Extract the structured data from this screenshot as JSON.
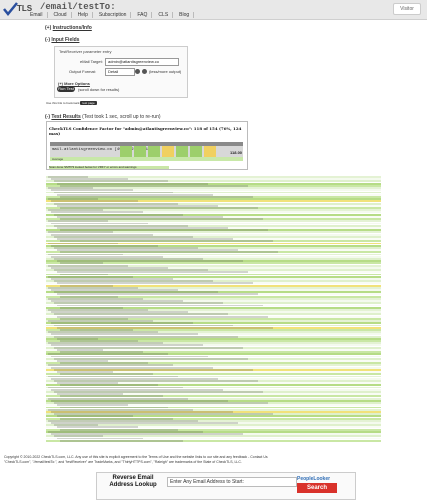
{
  "header": {
    "logo_text": "TLS",
    "path": "/email/testTo:",
    "menu": [
      "Email",
      "Cloud",
      "Help",
      "Subscription",
      "FAQ",
      "CLS",
      "Blog"
    ],
    "visitor_label": "Visitor"
  },
  "sections": {
    "instructions": "Instructions/Info",
    "input_fields": "Input Fields",
    "test_results": "Test Results",
    "test_results_hint": "(Test took 1 sec, scroll up to re-run)"
  },
  "form": {
    "legend": "TestReceiver parameter entry",
    "email_label": "eMail Target:",
    "email_value": "admin@atlantisgreenview.co",
    "output_label": "Output Format:",
    "output_value": "Detail",
    "output_hint": "(less/more output)",
    "more_options": "More Options",
    "run_button": "Run Test",
    "run_hint": "(scroll down for results)",
    "bookmark_note": "Use this link to bookmark",
    "bookmark_link": "test page"
  },
  "results": {
    "title": "CheckTLS Confidence Factor for \"admin@atlantisgreenview.co\": 118 of 154 (76%, 124 max)",
    "server_row": "mail.atlantisgreenview.co [49.76.227.211.25]",
    "score": "118.00",
    "average_label": "Average",
    "footer_note": "Scan done SMTP3 looked below for VRFY or errors and warnings"
  },
  "footer": {
    "copyright": "Copyright © 2010-2022 CheckTLS.com, LLC. Any use of this site is explicit agreement to the Terms of Use and the website links to our site and any feedback - Contact Us",
    "trademark": "\"CheckTLS.com\", \"//email/testTo:\", and \"testReceiver\" are TradeMarks, and \"ThirtyHTTPS.com\", \"Raleigh\" are trademarks of the State of CheckTLS, LLC."
  },
  "ad": {
    "title": "Reverse Email Address Lookup",
    "placeholder": "Enter Any Email Address to Start:",
    "brand": "PeopleLooker",
    "search_button": "Search"
  }
}
